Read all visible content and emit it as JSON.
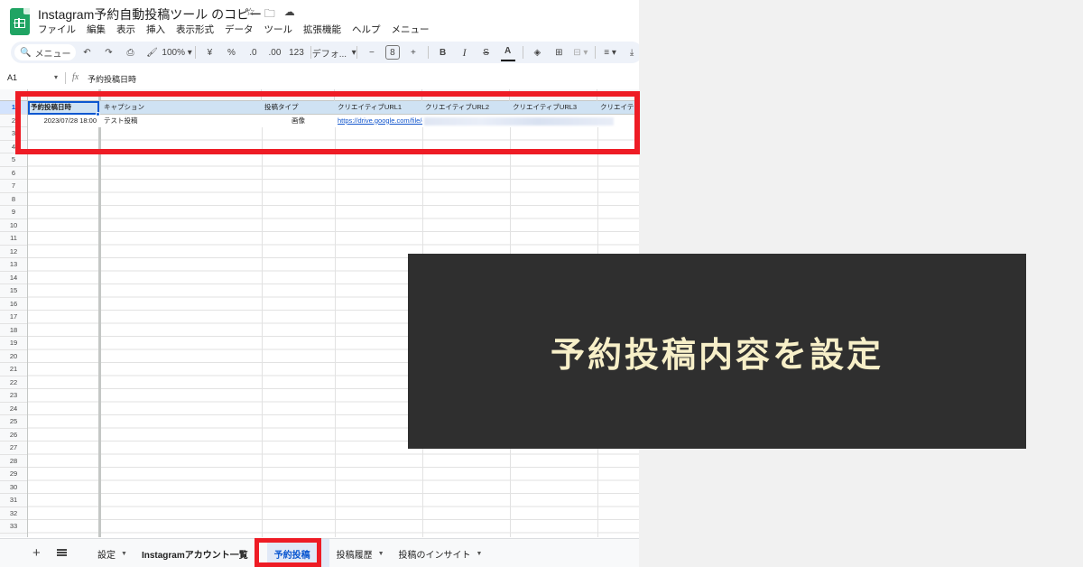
{
  "app": {
    "title": "Instagram予約自動投稿ツール のコピー",
    "menu": [
      "ファイル",
      "編集",
      "表示",
      "挿入",
      "表示形式",
      "データ",
      "ツール",
      "拡張機能",
      "ヘルプ",
      "メニュー"
    ]
  },
  "toolbar": {
    "search_label": "メニュー",
    "zoom": "100%",
    "currency": "¥",
    "percent": "%",
    "decimal_decrease": ".0",
    "decimal_increase": ".00",
    "number_format": "123",
    "font": "デフォ...",
    "font_size": "8",
    "bold": "B",
    "italic": "I",
    "strike": "S",
    "text_color": "A"
  },
  "formula": {
    "cell_ref": "A1",
    "fx": "fx",
    "value": "予約投稿日時"
  },
  "rows": [
    "1",
    "2",
    "3",
    "4",
    "5",
    "6",
    "7",
    "8",
    "9",
    "10",
    "11",
    "12",
    "13",
    "14",
    "15",
    "16",
    "17",
    "18",
    "19",
    "20",
    "21",
    "22",
    "23",
    "24",
    "25",
    "26",
    "27",
    "28",
    "29",
    "30",
    "31",
    "32",
    "33"
  ],
  "sheet": {
    "headers": [
      "予約投稿日時",
      "キャプション",
      "投稿タイプ",
      "クリエイティブURL1",
      "クリエイティブURL2",
      "クリエイティブURL3",
      "クリエイテ"
    ],
    "row2": {
      "datetime": "2023/07/28 18:00",
      "caption": "テスト投稿",
      "type": "画像",
      "url1": "https://drive.google.com/file/d"
    }
  },
  "tabs": [
    "設定",
    "Instagramアカウント一覧",
    "予約投稿",
    "投稿履歴",
    "投稿のインサイト"
  ],
  "overlay": {
    "text": "予約投稿内容を設定"
  },
  "colors": {
    "highlight": "#ee1c25",
    "overlay_bg": "#2f2f2f",
    "overlay_text": "#f7efc8",
    "header_row": "#cfe2f3",
    "accent": "#0b57d0"
  }
}
